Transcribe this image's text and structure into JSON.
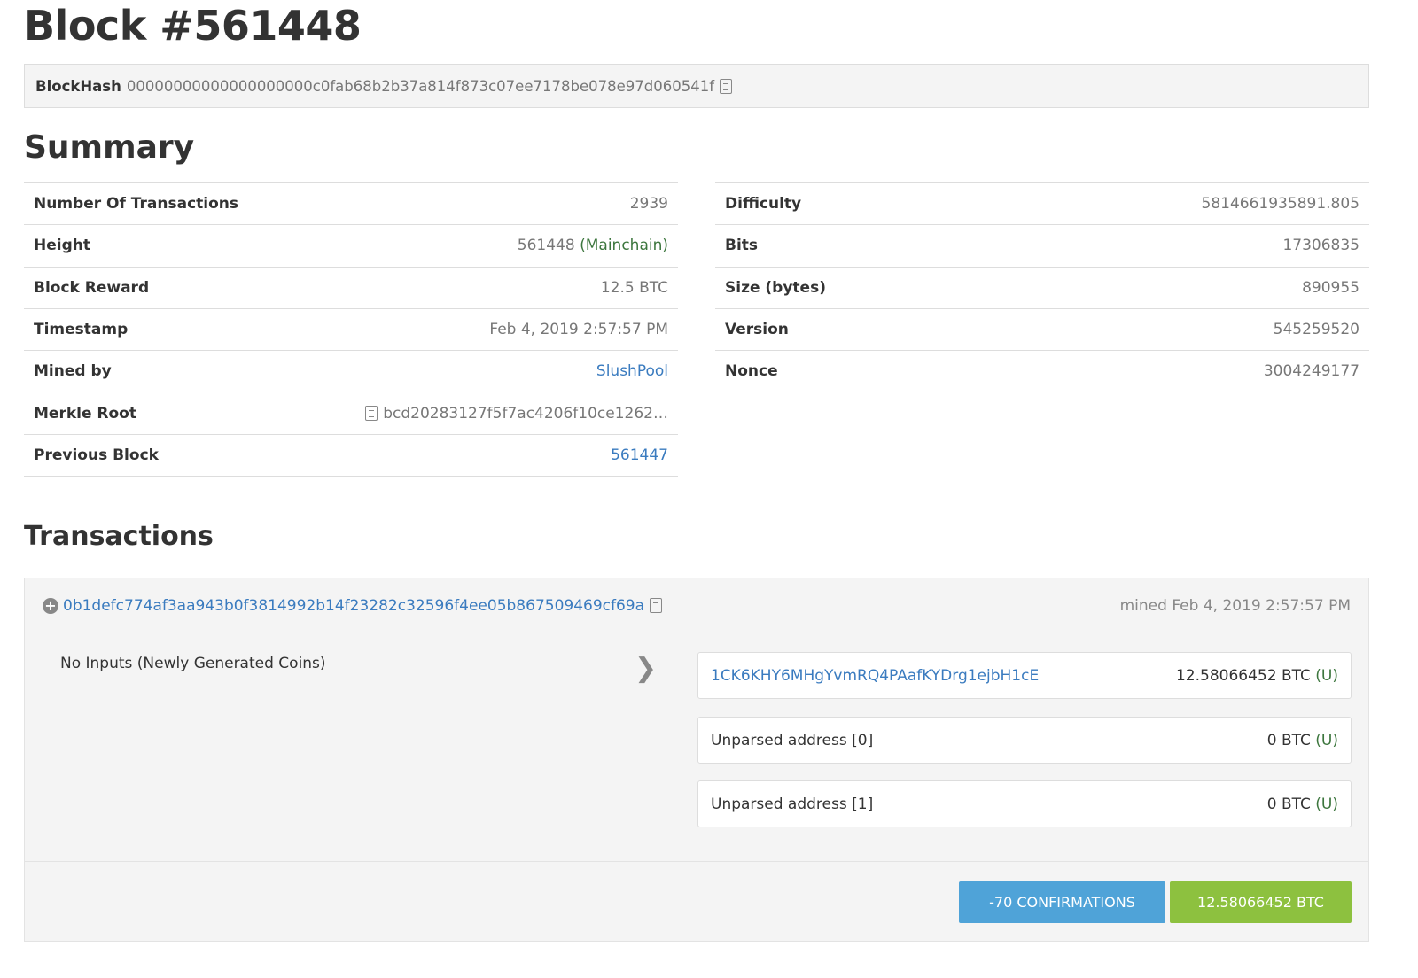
{
  "title": "Block #561448",
  "blockhash": {
    "label": "BlockHash",
    "value": "00000000000000000000c0fab68b2b37a814f873c07ee7178be078e97d060541f"
  },
  "summary": {
    "heading": "Summary",
    "left": [
      {
        "label": "Number Of Transactions",
        "value": "2939"
      },
      {
        "label": "Height",
        "value": "561448",
        "extra": "(Mainchain)"
      },
      {
        "label": "Block Reward",
        "value": "12.5 BTC"
      },
      {
        "label": "Timestamp",
        "value": "Feb 4, 2019 2:57:57 PM"
      },
      {
        "label": "Mined by",
        "value": "SlushPool"
      },
      {
        "label": "Merkle Root",
        "value": "bcd20283127f5f7ac4206f10ce1262…"
      },
      {
        "label": "Previous Block",
        "value": "561447"
      }
    ],
    "right": [
      {
        "label": "Difficulty",
        "value": "5814661935891.805"
      },
      {
        "label": "Bits",
        "value": "17306835"
      },
      {
        "label": "Size (bytes)",
        "value": "890955"
      },
      {
        "label": "Version",
        "value": "545259520"
      },
      {
        "label": "Nonce",
        "value": "3004249177"
      }
    ]
  },
  "transactions": {
    "heading": "Transactions",
    "tx": {
      "hash": "0b1defc774af3aa943b0f3814992b14f23282c32596f4ee05b867509469cf69a",
      "mined": "mined Feb 4, 2019 2:57:57 PM",
      "inputs": "No Inputs (Newly Generated Coins)",
      "outputs": [
        {
          "address": "1CK6KHY6MHgYvmRQ4PAafKYDrg1ejbH1cE",
          "amount": "12.58066452 BTC",
          "flag": "(U)"
        },
        {
          "address": "Unparsed address [0]",
          "amount": "0 BTC",
          "flag": "(U)"
        },
        {
          "address": "Unparsed address [1]",
          "amount": "0 BTC",
          "flag": "(U)"
        }
      ],
      "confirmations": "-70 CONFIRMATIONS",
      "total": "12.58066452 BTC"
    }
  },
  "colors": {
    "link": "#3a7bbf",
    "confirm": "#4fa3d8",
    "total": "#8dc13f"
  }
}
